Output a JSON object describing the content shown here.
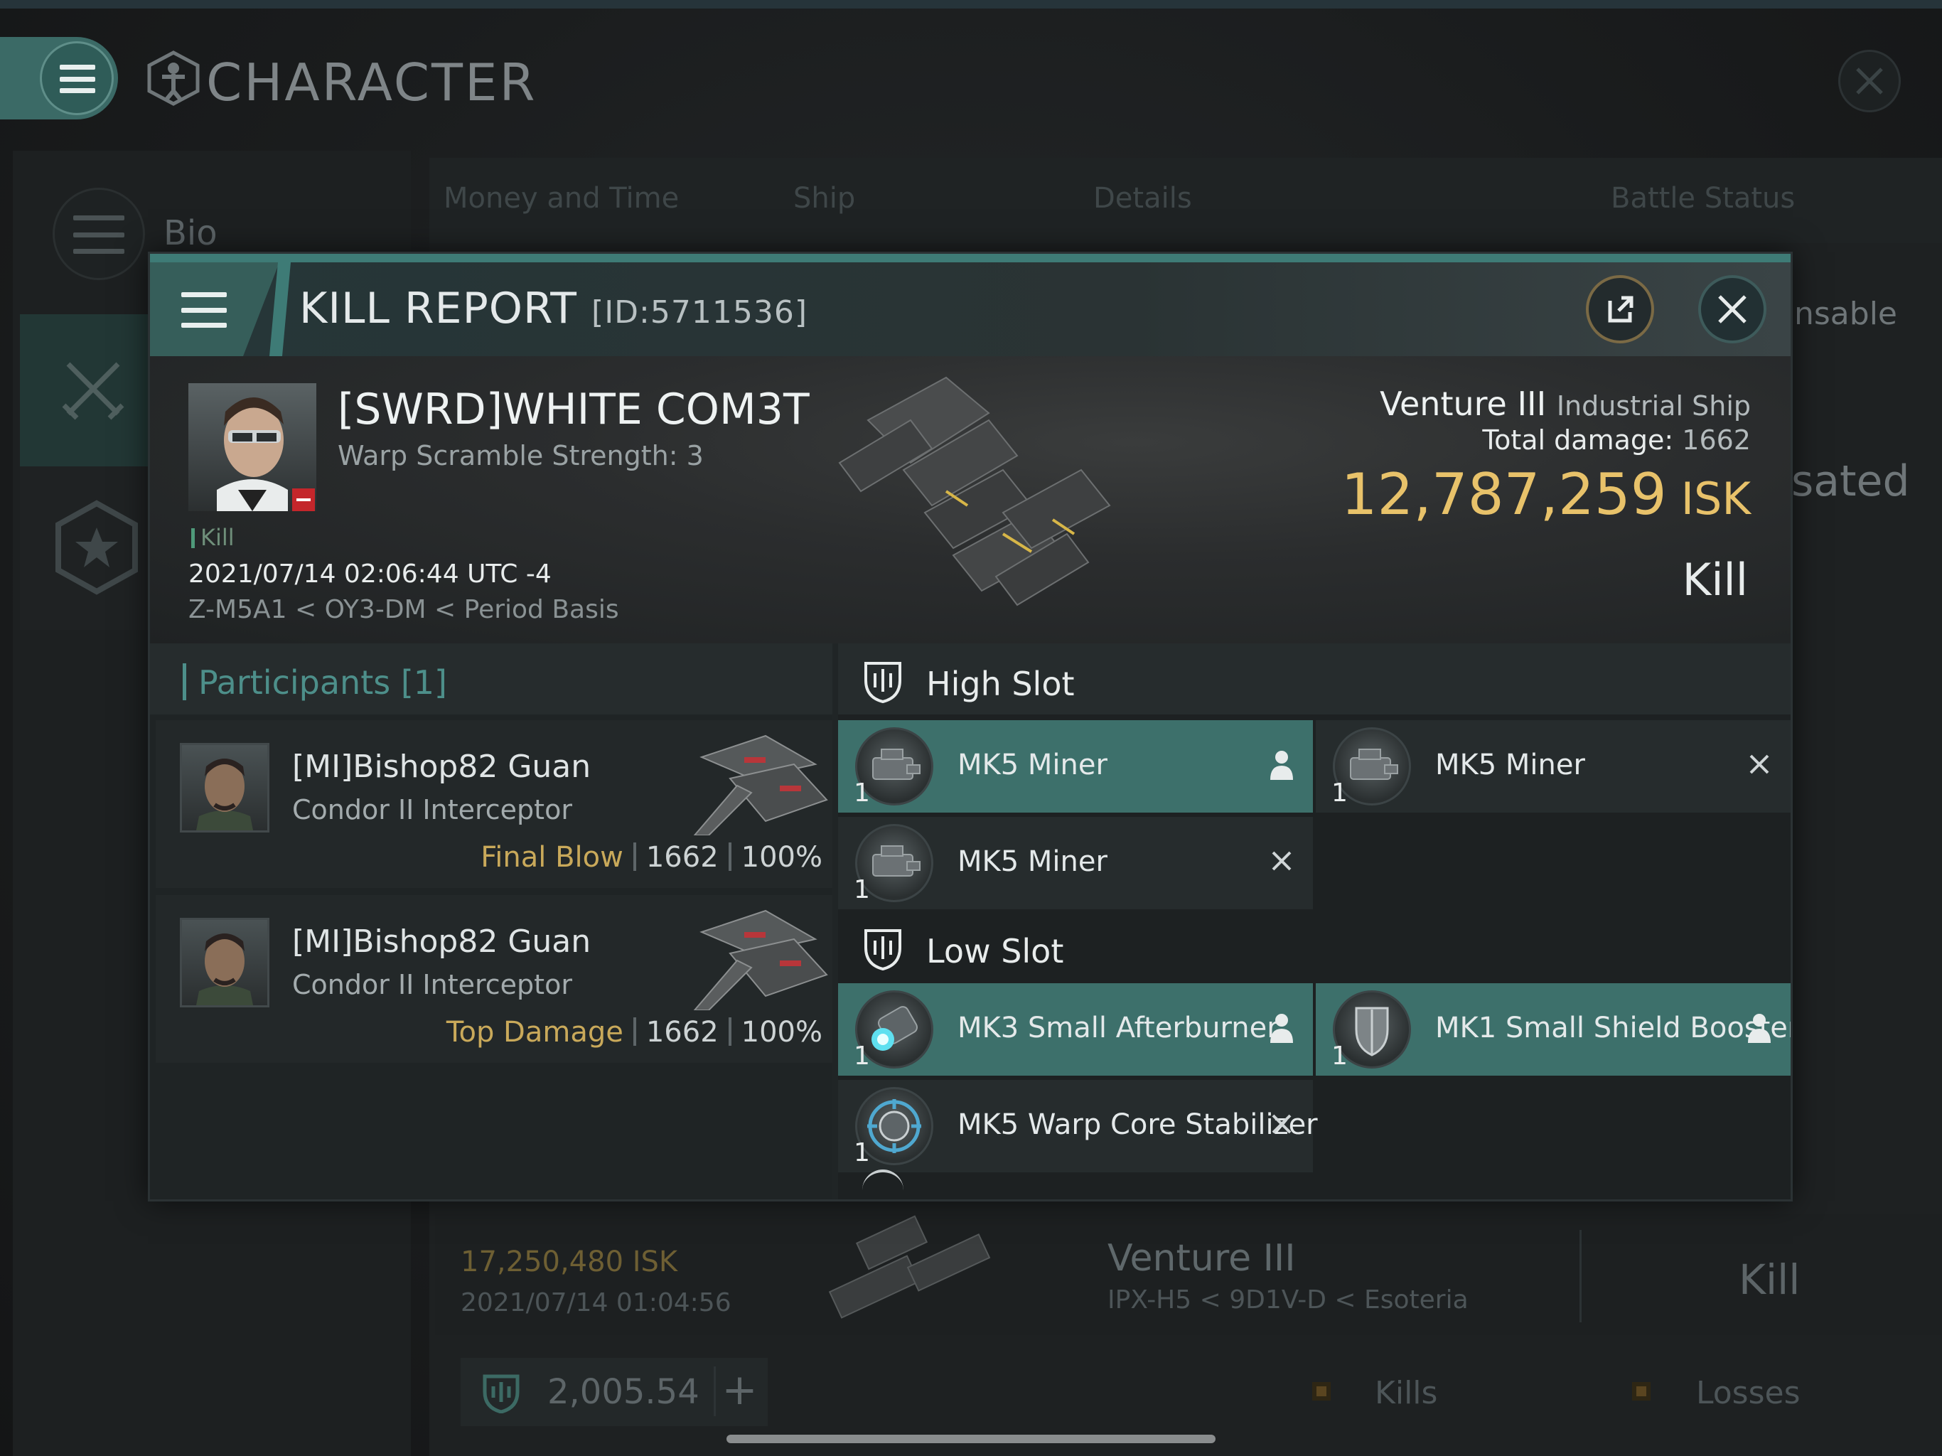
{
  "background": {
    "title": "CHARACTER",
    "sidebar": {
      "bio_label": "Bio"
    },
    "tabs": [
      "Money and Time",
      "Ship",
      "Details",
      "Battle Status"
    ],
    "right_stubs": [
      "nsable",
      "sated"
    ],
    "prev_kill": {
      "isk": "17,250,480 ISK",
      "date": "2021/07/14  01:04:56",
      "ship": "Venture III",
      "location": "IPX-H5 < 9D1V-D < Esoteria",
      "result": "Kill"
    },
    "wallet": {
      "value": "2,005.54",
      "plus": "+"
    },
    "legend": {
      "kills": "Kills",
      "losses": "Losses"
    }
  },
  "kill_report": {
    "title": "KILL REPORT",
    "id": "[ID:5711536]",
    "victim": {
      "name": "[SWRD]WHITE COM3T",
      "scram": "Warp Scramble Strength: 3",
      "tag": "Kill",
      "date": "2021/07/14 02:06:44 UTC -4",
      "location": "Z-M5A1 < OY3-DM < Period Basis"
    },
    "ship": {
      "name": "Venture III",
      "class": "Industrial Ship",
      "total_damage_label": "Total damage:",
      "total_damage": "1662",
      "isk_value": "12,787,259",
      "isk_unit": "ISK",
      "result": "Kill"
    },
    "participants": {
      "title": "Participants [1]",
      "rows": [
        {
          "name": "[MI]Bishop82 Guan",
          "ship": "Condor II Interceptor",
          "label": "Final Blow",
          "damage": "1662",
          "percent": "100%"
        },
        {
          "name": "[MI]Bishop82 Guan",
          "ship": "Condor II Interceptor",
          "label": "Top Damage",
          "damage": "1662",
          "percent": "100%"
        }
      ]
    },
    "high_slot": {
      "title": "High Slot",
      "modules": [
        {
          "name": "MK5 Miner",
          "qty": "1",
          "status": "dropped",
          "icon": "miner-icon"
        },
        {
          "name": "MK5 Miner",
          "qty": "1",
          "status": "destroyed",
          "icon": "miner-icon"
        },
        {
          "name": "MK5 Miner",
          "qty": "1",
          "status": "destroyed",
          "icon": "miner-icon"
        }
      ]
    },
    "low_slot": {
      "title": "Low Slot",
      "modules": [
        {
          "name": "MK3 Small Afterburner",
          "qty": "1",
          "status": "dropped",
          "icon": "afterburner-icon"
        },
        {
          "name": "MK1 Small Shield Booster",
          "qty": "1",
          "status": "dropped",
          "icon": "shield-booster-icon"
        },
        {
          "name": "MK5 Warp Core Stabilizer",
          "qty": "1",
          "status": "destroyed",
          "icon": "warp-core-stabilizer-icon"
        }
      ]
    }
  },
  "colors": {
    "accent": "#3e7b76",
    "isk_gold": "#e8c26a",
    "highlight_row": "#3d706b"
  }
}
